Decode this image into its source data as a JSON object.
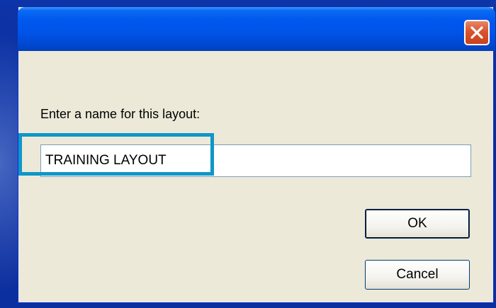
{
  "dialog": {
    "prompt": "Enter a name for this layout:",
    "input_value": "TRAINING LAYOUT",
    "ok_label": "OK",
    "cancel_label": "Cancel"
  },
  "icons": {
    "close": "close-icon"
  },
  "colors": {
    "desktop_background": "#0b2f9c",
    "title_bar": "#0058ee",
    "dialog_face": "#ece9d8",
    "close_button": "#d9542e",
    "highlight_outline": "#0f97c8"
  }
}
